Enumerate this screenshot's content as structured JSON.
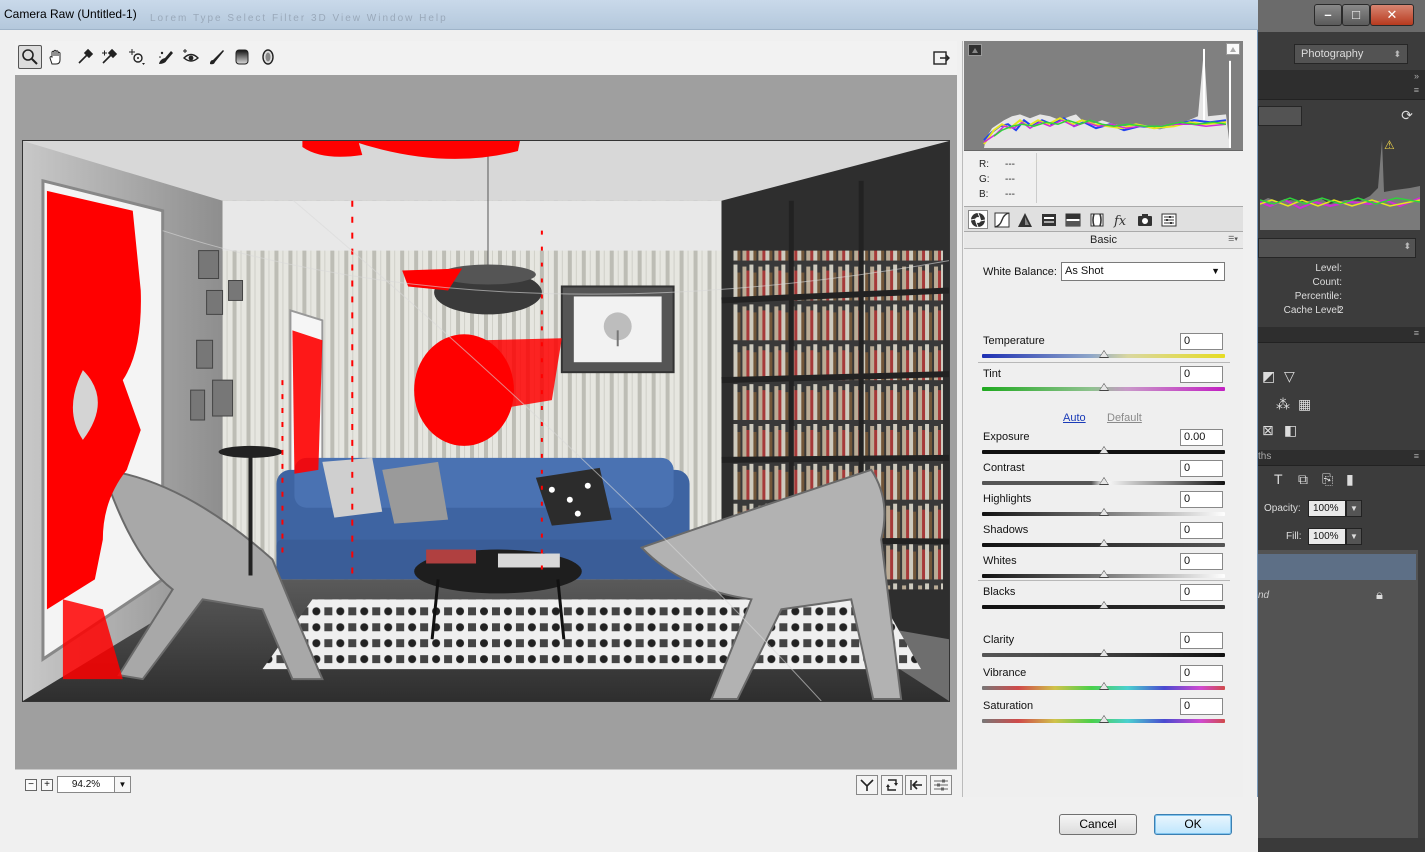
{
  "window": {
    "title": "Camera Raw (Untitled-1)",
    "menu_ghost": "Lorem Type Select Filter 3D View Window Help"
  },
  "toolbar": {
    "tools": [
      {
        "name": "zoom-tool",
        "icon": "zoom-icon",
        "active": true
      },
      {
        "name": "hand-tool",
        "icon": "hand-icon"
      },
      {
        "name": "white-balance-tool",
        "icon": "eyedropper-icon"
      },
      {
        "name": "color-sampler-tool",
        "icon": "color-sampler-icon"
      },
      {
        "name": "targeted-adjustment-tool",
        "icon": "target-adjust-icon"
      },
      {
        "name": "spot-removal-tool",
        "icon": "spot-removal-icon"
      },
      {
        "name": "red-eye-tool",
        "icon": "red-eye-icon"
      },
      {
        "name": "adjustment-brush-tool",
        "icon": "brush-icon"
      },
      {
        "name": "graduated-filter-tool",
        "icon": "graduated-filter-icon"
      },
      {
        "name": "radial-filter-tool",
        "icon": "radial-filter-icon"
      }
    ],
    "open_preferences_icon": "open-preferences-icon"
  },
  "histogram": {
    "readout": {
      "r_label": "R:",
      "g_label": "G:",
      "b_label": "B:",
      "r": "---",
      "g": "---",
      "b": "---"
    },
    "colors": {
      "red": "#e8232b",
      "green": "#2fd33b",
      "blue": "#2244ee",
      "yellow": "#e6e61c",
      "magenta": "#d22bd8",
      "cyan": "#38d4d4",
      "white": "#ffffff"
    }
  },
  "panel_tabs": [
    {
      "name": "tab-basic",
      "icon": "aperture-icon",
      "active": true
    },
    {
      "name": "tab-tone-curve",
      "icon": "tone-curve-icon"
    },
    {
      "name": "tab-detail",
      "icon": "detail-triangle-icon"
    },
    {
      "name": "tab-hsl",
      "icon": "hsl-icon"
    },
    {
      "name": "tab-split-toning",
      "icon": "split-toning-icon"
    },
    {
      "name": "tab-lens-corrections",
      "icon": "lens-icon"
    },
    {
      "name": "tab-effects",
      "icon": "fx-icon"
    },
    {
      "name": "tab-camera-calibration",
      "icon": "camera-icon"
    },
    {
      "name": "tab-presets",
      "icon": "presets-icon"
    }
  ],
  "basic": {
    "section_title": "Basic",
    "white_balance": {
      "label": "White Balance:",
      "value": "As Shot"
    },
    "auto": "Auto",
    "default": "Default",
    "sliders": [
      {
        "label": "Temperature",
        "value": "0",
        "position": 0.5,
        "track": "temperature"
      },
      {
        "label": "Tint",
        "value": "0",
        "position": 0.5,
        "track": "tint"
      },
      {
        "label": "Exposure",
        "value": "0.00",
        "position": 0.5,
        "track": "gray"
      },
      {
        "label": "Contrast",
        "value": "0",
        "position": 0.5,
        "track": "gray"
      },
      {
        "label": "Highlights",
        "value": "0",
        "position": 0.5,
        "track": "highlights"
      },
      {
        "label": "Shadows",
        "value": "0",
        "position": 0.5,
        "track": "gray"
      },
      {
        "label": "Whites",
        "value": "0",
        "position": 0.5,
        "track": "highlights"
      },
      {
        "label": "Blacks",
        "value": "0",
        "position": 0.5,
        "track": "gray"
      },
      {
        "label": "Clarity",
        "value": "0",
        "position": 0.5,
        "track": "gray"
      },
      {
        "label": "Vibrance",
        "value": "0",
        "position": 0.5,
        "track": "spectrum"
      },
      {
        "label": "Saturation",
        "value": "0",
        "position": 0.5,
        "track": "spectrum"
      }
    ]
  },
  "statusbar": {
    "zoom_out": "−",
    "zoom_in": "+",
    "zoom_value": "94.2%",
    "view_buttons": [
      {
        "name": "before-after-view-button",
        "icon": "before-after-icon"
      },
      {
        "name": "swap-settings-button",
        "icon": "swap-icon"
      },
      {
        "name": "copy-settings-button",
        "icon": "copy-settings-icon"
      },
      {
        "name": "toggle-settings-button",
        "icon": "toggle-settings-icon"
      }
    ]
  },
  "footer": {
    "cancel": "Cancel",
    "ok": "OK"
  },
  "photoshop": {
    "workspace": "Photography",
    "histogram_stats": {
      "level_label": "Level:",
      "count_label": "Count:",
      "percentile_label": "Percentile:",
      "cache_label": "Cache Level:",
      "cache_value": "2"
    },
    "opacity_label": "Opacity:",
    "opacity_value": "100%",
    "fill_label": "Fill:",
    "fill_value": "100%",
    "panel_tab_fragment": "ths",
    "layer_fragment": "nd"
  }
}
